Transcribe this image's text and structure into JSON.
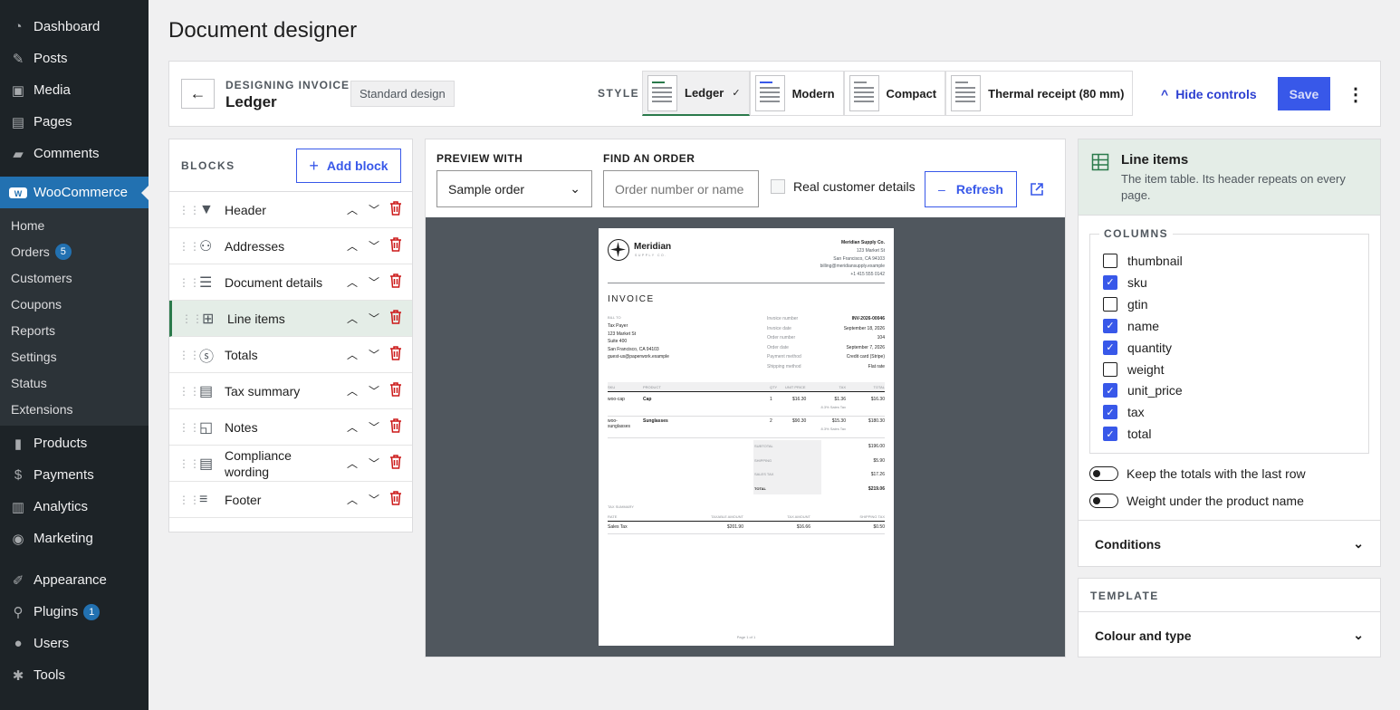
{
  "sidebar": {
    "top": [
      {
        "label": "Dashboard",
        "icon": "dashboard-icon"
      },
      {
        "label": "Posts",
        "icon": "pin-icon"
      },
      {
        "label": "Media",
        "icon": "media-icon"
      },
      {
        "label": "Pages",
        "icon": "pages-icon"
      },
      {
        "label": "Comments",
        "icon": "comments-icon"
      }
    ],
    "woo": {
      "label": "WooCommerce",
      "icon": "woo-icon"
    },
    "woo_sub": [
      {
        "label": "Home"
      },
      {
        "label": "Orders",
        "badge": "5"
      },
      {
        "label": "Customers"
      },
      {
        "label": "Coupons"
      },
      {
        "label": "Reports"
      },
      {
        "label": "Settings"
      },
      {
        "label": "Status"
      },
      {
        "label": "Extensions"
      }
    ],
    "mid": [
      {
        "label": "Products",
        "icon": "products-icon"
      },
      {
        "label": "Payments",
        "icon": "payments-icon"
      },
      {
        "label": "Analytics",
        "icon": "analytics-icon"
      },
      {
        "label": "Marketing",
        "icon": "marketing-icon"
      }
    ],
    "bottom": [
      {
        "label": "Appearance",
        "icon": "appearance-icon"
      },
      {
        "label": "Plugins",
        "icon": "plugins-icon",
        "badge": "1"
      },
      {
        "label": "Users",
        "icon": "users-icon"
      },
      {
        "label": "Tools",
        "icon": "tools-icon"
      }
    ]
  },
  "page": {
    "title": "Document designer"
  },
  "topbar": {
    "designing_label": "DESIGNING INVOICE",
    "design_name": "Ledger",
    "standard_badge": "Standard design",
    "style_label": "STYLE",
    "styles": [
      {
        "label": "Ledger",
        "selected": true,
        "check": "✓"
      },
      {
        "label": "Modern"
      },
      {
        "label": "Compact"
      },
      {
        "label": "Thermal receipt (80 mm)"
      }
    ],
    "hide_controls": "Hide controls",
    "save": "Save"
  },
  "blocks": {
    "title": "BLOCKS",
    "add": "Add block",
    "items": [
      {
        "label": "Header"
      },
      {
        "label": "Addresses"
      },
      {
        "label": "Document details"
      },
      {
        "label": "Line items",
        "selected": true
      },
      {
        "label": "Totals"
      },
      {
        "label": "Tax summary"
      },
      {
        "label": "Notes"
      },
      {
        "label": "Compliance wording"
      },
      {
        "label": "Footer"
      }
    ]
  },
  "preview": {
    "preview_with_label": "PREVIEW WITH",
    "preview_with_value": "Sample order",
    "find_label": "FIND AN ORDER",
    "find_placeholder": "Order number or name",
    "real_customer": "Real customer details",
    "refresh": "Refresh"
  },
  "invoice": {
    "company": "Meridian",
    "company_sub": "SUPPLY CO.",
    "from_name": "Meridian Supply Co.",
    "from_lines": [
      "123 Market St",
      "San Francisco, CA 94103",
      "billing@meridiansupply.example",
      "+1 415 555 0142"
    ],
    "heading": "INVOICE",
    "bill_to_label": "BILL TO",
    "bill_to": [
      "Tax Payer",
      "123 Market St",
      "Suite 400",
      "San Francisco, CA 94103",
      "guest-us@paperwork.example"
    ],
    "meta": [
      [
        "Invoice number",
        "INV-2026-00046"
      ],
      [
        "Invoice date",
        "September 18, 2026"
      ],
      [
        "Order number",
        "104"
      ],
      [
        "Order date",
        "September 7, 2026"
      ],
      [
        "Payment method",
        "Credit card (Stripe)"
      ],
      [
        "Shipping method",
        "Flat rate"
      ]
    ],
    "cols": [
      "SKU",
      "PRODUCT",
      "QTY",
      "UNIT PRICE",
      "TAX",
      "TOTAL"
    ],
    "rows": [
      {
        "sku": "woo-cap",
        "product": "Cap",
        "qty": "1",
        "unit": "$16.30",
        "tax": "$1.36",
        "total": "$16.30",
        "note": "8.3% Sales Tax"
      },
      {
        "sku": "woo-sunglasses",
        "product": "Sunglasses",
        "qty": "2",
        "unit": "$90.30",
        "tax": "$15.30",
        "total": "$180.30",
        "note": "8.3% Sales Tax"
      }
    ],
    "totals": [
      [
        "SUBTOTAL",
        "$196.00"
      ],
      [
        "SHIPPING",
        "$5.90"
      ],
      [
        "SALES TAX",
        "$17.26"
      ],
      [
        "TOTAL",
        "$219.06"
      ]
    ],
    "tax_title": "TAX SUMMARY",
    "tax_cols": [
      "RATE",
      "TAXABLE AMOUNT",
      "TAX AMOUNT",
      "SHIPPING TAX"
    ],
    "tax_row": [
      "Sales Tax",
      "$201.90",
      "$16.66",
      "$0.50"
    ],
    "page_footer": "Page 1 of 1"
  },
  "inspector": {
    "title": "Line items",
    "desc": "The item table. Its header repeats on every page.",
    "columns_label": "COLUMNS",
    "columns": [
      {
        "name": "thumbnail",
        "on": false
      },
      {
        "name": "sku",
        "on": true
      },
      {
        "name": "gtin",
        "on": false
      },
      {
        "name": "name",
        "on": true
      },
      {
        "name": "quantity",
        "on": true
      },
      {
        "name": "weight",
        "on": false
      },
      {
        "name": "unit_price",
        "on": true
      },
      {
        "name": "tax",
        "on": true
      },
      {
        "name": "total",
        "on": true
      }
    ],
    "toggle1": "Keep the totals with the last row",
    "toggle2": "Weight under the product name",
    "conditions": "Conditions"
  },
  "template": {
    "label": "TEMPLATE",
    "colour": "Colour and type"
  },
  "colors": {
    "accent": "#3858e9",
    "selected": "#2a7a4b",
    "wp_blue": "#2271b1"
  }
}
